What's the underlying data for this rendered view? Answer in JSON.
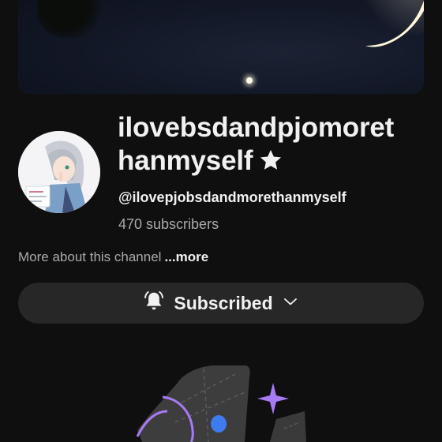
{
  "banner": {
    "icon": "night-sky-moon-banner"
  },
  "channel": {
    "name_line1": "ilovebsdandpjomoret",
    "name_line2": "hanmyself",
    "badge_icon": "star-icon",
    "handle": "@ilovepjobsdandmorethanmyself",
    "subscribers": "470 subscribers",
    "about_text": "More about this channel",
    "more_label": "...more"
  },
  "subscribe_button": {
    "label": "Subscribed",
    "bell_icon": "bell-ringing-icon",
    "chevron_icon": "chevron-down-icon"
  },
  "illustration": {
    "icon": "empty-state-illustration"
  },
  "colors": {
    "background": "#0f0f0f",
    "text_primary": "#f1f1f1",
    "text_secondary": "#aaaaaa",
    "button_bg": "#272727",
    "accent_purple": "#a77bf3",
    "accent_blue": "#3f7bf0"
  }
}
